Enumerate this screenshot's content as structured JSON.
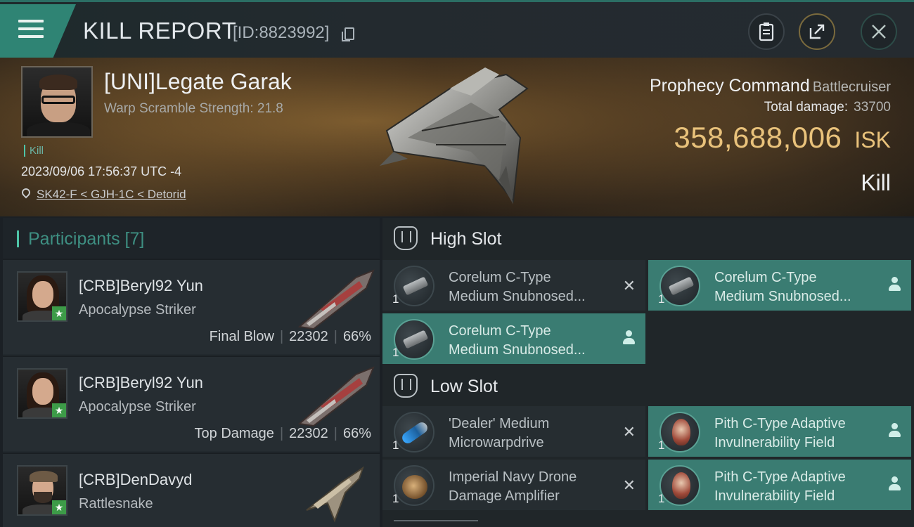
{
  "header": {
    "title": "KILL REPORT",
    "report_id": "[ID:8823992]"
  },
  "victim": {
    "name": "[UNI]Legate Garak",
    "warp_scramble": "Warp Scramble Strength: 21.8",
    "tag": "Kill",
    "datetime": "2023/09/06 17:56:37 UTC -4",
    "location": "SK42-F < GJH-1C < Detorid",
    "ship_name": "Prophecy Command",
    "ship_class": "Battlecruiser",
    "total_damage_label": "Total damage:",
    "total_damage": "33700",
    "isk_value": "358,688,006",
    "isk_unit": "ISK",
    "result": "Kill"
  },
  "participants": {
    "title": "Participants [7]",
    "rows": [
      {
        "name": "[CRB]Beryl92 Yun",
        "ship": "Apocalypse Striker",
        "role": "Final Blow",
        "damage": "22302",
        "percent": "66%"
      },
      {
        "name": "[CRB]Beryl92 Yun",
        "ship": "Apocalypse Striker",
        "role": "Top Damage",
        "damage": "22302",
        "percent": "66%"
      },
      {
        "name": "[CRB]DenDavyd",
        "ship": "Rattlesnake",
        "role": "",
        "damage": "",
        "percent": ""
      }
    ]
  },
  "fitting": {
    "high_slot_title": "High Slot",
    "low_slot_title": "Low Slot",
    "high": [
      {
        "line1": "Corelum C-Type",
        "line2": "Medium Snubnosed...",
        "qty": "1",
        "status": "dropped",
        "icon": "turret-icon"
      },
      {
        "line1": "Corelum C-Type",
        "line2": "Medium Snubnosed...",
        "qty": "1",
        "status": "destroyed",
        "icon": "turret-icon"
      },
      {
        "line1": "Corelum C-Type",
        "line2": "Medium Snubnosed...",
        "qty": "1",
        "status": "destroyed",
        "icon": "turret-icon"
      }
    ],
    "low": [
      {
        "line1": "'Dealer' Medium",
        "line2": "Microwarpdrive",
        "qty": "1",
        "status": "dropped",
        "icon": "microwarpdrive-icon"
      },
      {
        "line1": "Pith C-Type Adaptive",
        "line2": "Invulnerability Field",
        "qty": "1",
        "status": "destroyed",
        "icon": "shield-module-icon"
      },
      {
        "line1": "Imperial Navy Drone",
        "line2": "Damage Amplifier",
        "qty": "1",
        "status": "dropped",
        "icon": "drone-amplifier-icon"
      },
      {
        "line1": "Pith C-Type Adaptive",
        "line2": "Invulnerability Field",
        "qty": "1",
        "status": "destroyed",
        "icon": "shield-module-icon"
      }
    ],
    "dropped_glyph": "✕"
  },
  "colors": {
    "accent_teal": "#2f8474",
    "isk_gold": "#e9c27b",
    "lost_module_bg": "#3a7c72"
  }
}
